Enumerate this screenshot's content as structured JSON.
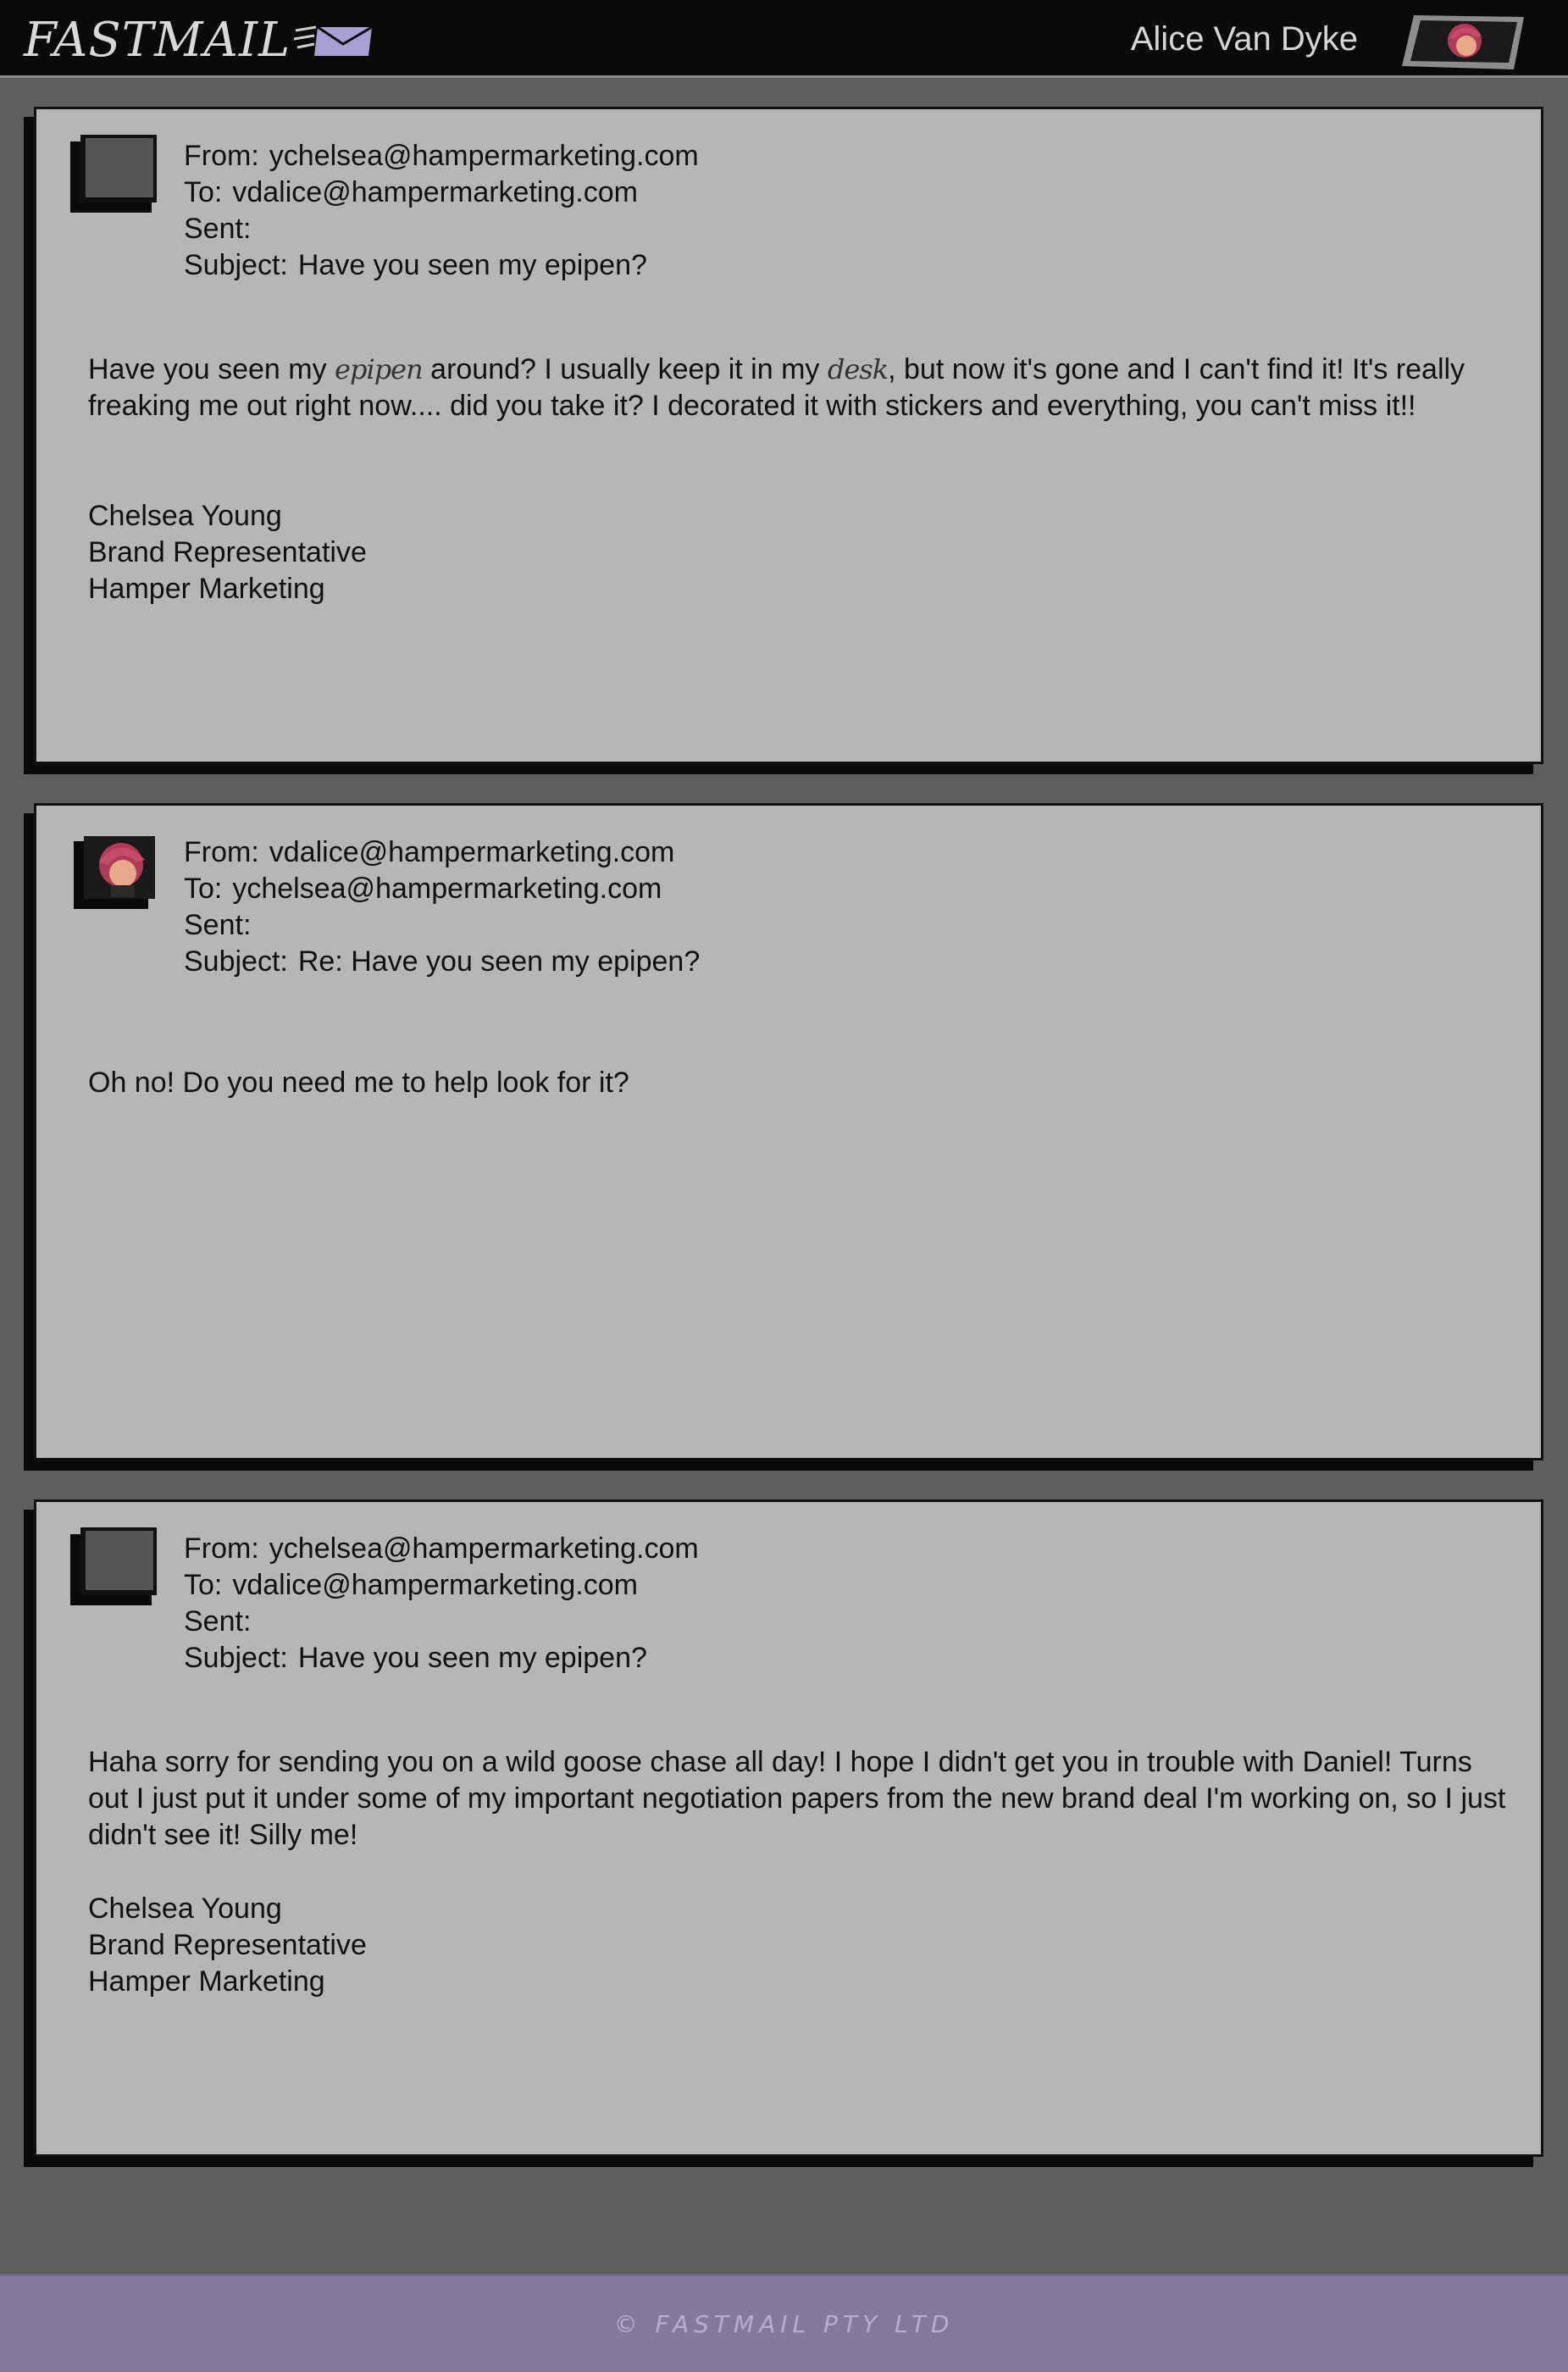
{
  "header": {
    "logo_text": "FASTMAIL",
    "user_name": "Alice Van Dyke",
    "logo_icon": "envelope-icon",
    "avatar_icon": "user-avatar"
  },
  "emails": [
    {
      "from_label": "From:",
      "from": "ychelsea@hampermarketing.com",
      "to_label": "To:",
      "to": "vdalice@hampermarketing.com",
      "sent_label": "Sent:",
      "sent": "",
      "subject_label": "Subject:",
      "subject": "Have you seen my epipen?",
      "body_part1": "Have you seen my ",
      "body_hand1": "epipen",
      "body_part2": " around? I usually keep it in my ",
      "body_hand2": "desk",
      "body_part3": ", but now it's gone and I can't find it! It's really freaking me out right now.... did you take it? I decorated it with stickers and everything, you can't miss it!!",
      "signature": [
        "Chelsea Young",
        "Brand Representative",
        "Hamper Marketing"
      ]
    },
    {
      "from_label": "From:",
      "from": "vdalice@hampermarketing.com",
      "to_label": "To:",
      "to": "ychelsea@hampermarketing.com",
      "sent_label": "Sent:",
      "sent": "",
      "subject_label": "Subject:",
      "subject": "Re: Have you seen my epipen?",
      "body": "Oh no! Do you need me to help look for it?"
    },
    {
      "from_label": "From:",
      "from": "ychelsea@hampermarketing.com",
      "to_label": "To:",
      "to": "vdalice@hampermarketing.com",
      "sent_label": "Sent:",
      "sent": "",
      "subject_label": "Subject:",
      "subject": "Have you seen my epipen?",
      "body": "Haha sorry for sending you on a wild goose chase all day! I hope I didn't get you in trouble with Daniel! Turns out I just put it under some of my important negotiation papers from the new brand deal I'm working on, so I just didn't see it! Silly me!",
      "signature": [
        "Chelsea Young",
        "Brand Representative",
        "Hamper Marketing"
      ]
    }
  ],
  "footer": {
    "text": "© FASTMAIL PTY LTD"
  },
  "colors": {
    "topbar": "#0a0a0a",
    "page_bg": "#5e5e5e",
    "card_bg": "#b6b6b6",
    "footer_bg": "#847b9c"
  }
}
